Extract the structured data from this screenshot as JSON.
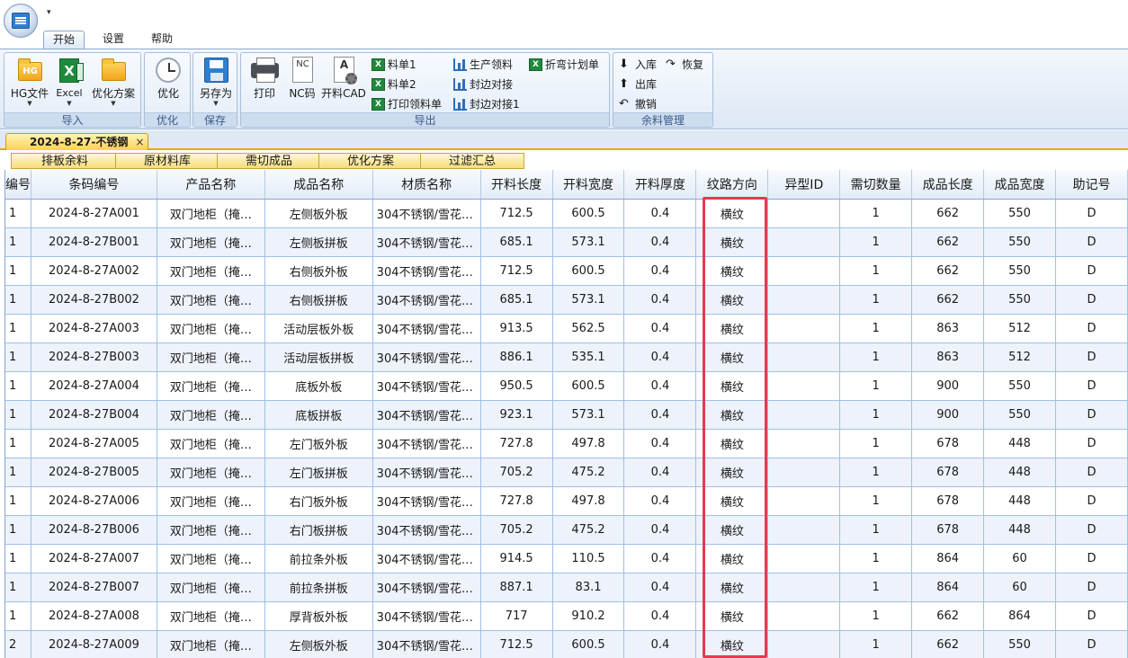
{
  "quick_access_glyph": "▾",
  "ribbon_tabs": [
    "开始",
    "设置",
    "帮助"
  ],
  "groups": {
    "import": {
      "label": "导入",
      "hg": {
        "icon_text": "HG",
        "label": "HG文件"
      },
      "excel": {
        "icon_text": "X",
        "label": "Excel"
      },
      "plan": {
        "label": "优化方案"
      }
    },
    "optimize": {
      "label": "优化",
      "button": "优化"
    },
    "save": {
      "label": "保存",
      "button": "另存为"
    },
    "export": {
      "label": "导出",
      "print": "打印",
      "nc": {
        "icon_text": "NC",
        "label": "NC码"
      },
      "cad": {
        "icon_text": "A",
        "label": "开料CAD"
      },
      "list1": "料单1",
      "list2": "料单2",
      "print_pick": "打印领料单",
      "prod_pick": "生产领料",
      "edge_join": "封边对接",
      "edge_join1": "封边对接1",
      "bend_plan": "折弯计划单"
    },
    "remnant": {
      "label": "余料管理",
      "in": "入库",
      "restore": "恢复",
      "out": "出库",
      "undo": "撤销"
    }
  },
  "document_tab": {
    "title": "2024-8-27-不锈钢",
    "close": "×"
  },
  "sub_tabs": [
    "排板余料",
    "原材料库",
    "需切成品",
    "优化方案",
    "过滤汇总"
  ],
  "grid": {
    "columns": [
      "编号",
      "条码编号",
      "产品名称",
      "成品名称",
      "材质名称",
      "开料长度",
      "开料宽度",
      "开料厚度",
      "纹路方向",
      "异型ID",
      "需切数量",
      "成品长度",
      "成品宽度",
      "助记号"
    ],
    "rows": [
      [
        "1",
        "2024-8-27A001",
        "双门地柜（掩…",
        "左侧板外板",
        "304不锈钢/雪花…",
        "712.5",
        "600.5",
        "0.4",
        "横纹",
        "",
        "1",
        "662",
        "550",
        "D"
      ],
      [
        "1",
        "2024-8-27B001",
        "双门地柜（掩…",
        "左侧板拼板",
        "304不锈钢/雪花…",
        "685.1",
        "573.1",
        "0.4",
        "横纹",
        "",
        "1",
        "662",
        "550",
        "D"
      ],
      [
        "1",
        "2024-8-27A002",
        "双门地柜（掩…",
        "右侧板外板",
        "304不锈钢/雪花…",
        "712.5",
        "600.5",
        "0.4",
        "横纹",
        "",
        "1",
        "662",
        "550",
        "D"
      ],
      [
        "1",
        "2024-8-27B002",
        "双门地柜（掩…",
        "右侧板拼板",
        "304不锈钢/雪花…",
        "685.1",
        "573.1",
        "0.4",
        "横纹",
        "",
        "1",
        "662",
        "550",
        "D"
      ],
      [
        "1",
        "2024-8-27A003",
        "双门地柜（掩…",
        "活动层板外板",
        "304不锈钢/雪花…",
        "913.5",
        "562.5",
        "0.4",
        "横纹",
        "",
        "1",
        "863",
        "512",
        "D"
      ],
      [
        "1",
        "2024-8-27B003",
        "双门地柜（掩…",
        "活动层板拼板",
        "304不锈钢/雪花…",
        "886.1",
        "535.1",
        "0.4",
        "横纹",
        "",
        "1",
        "863",
        "512",
        "D"
      ],
      [
        "1",
        "2024-8-27A004",
        "双门地柜（掩…",
        "底板外板",
        "304不锈钢/雪花…",
        "950.5",
        "600.5",
        "0.4",
        "横纹",
        "",
        "1",
        "900",
        "550",
        "D"
      ],
      [
        "1",
        "2024-8-27B004",
        "双门地柜（掩…",
        "底板拼板",
        "304不锈钢/雪花…",
        "923.1",
        "573.1",
        "0.4",
        "横纹",
        "",
        "1",
        "900",
        "550",
        "D"
      ],
      [
        "1",
        "2024-8-27A005",
        "双门地柜（掩…",
        "左门板外板",
        "304不锈钢/雪花…",
        "727.8",
        "497.8",
        "0.4",
        "横纹",
        "",
        "1",
        "678",
        "448",
        "D"
      ],
      [
        "1",
        "2024-8-27B005",
        "双门地柜（掩…",
        "左门板拼板",
        "304不锈钢/雪花…",
        "705.2",
        "475.2",
        "0.4",
        "横纹",
        "",
        "1",
        "678",
        "448",
        "D"
      ],
      [
        "1",
        "2024-8-27A006",
        "双门地柜（掩…",
        "右门板外板",
        "304不锈钢/雪花…",
        "727.8",
        "497.8",
        "0.4",
        "横纹",
        "",
        "1",
        "678",
        "448",
        "D"
      ],
      [
        "1",
        "2024-8-27B006",
        "双门地柜（掩…",
        "右门板拼板",
        "304不锈钢/雪花…",
        "705.2",
        "475.2",
        "0.4",
        "横纹",
        "",
        "1",
        "678",
        "448",
        "D"
      ],
      [
        "1",
        "2024-8-27A007",
        "双门地柜（掩…",
        "前拉条外板",
        "304不锈钢/雪花…",
        "914.5",
        "110.5",
        "0.4",
        "横纹",
        "",
        "1",
        "864",
        "60",
        "D"
      ],
      [
        "1",
        "2024-8-27B007",
        "双门地柜（掩…",
        "前拉条拼板",
        "304不锈钢/雪花…",
        "887.1",
        "83.1",
        "0.4",
        "横纹",
        "",
        "1",
        "864",
        "60",
        "D"
      ],
      [
        "1",
        "2024-8-27A008",
        "双门地柜（掩…",
        "厚背板外板",
        "304不锈钢/雪花…",
        "717",
        "910.2",
        "0.4",
        "横纹",
        "",
        "1",
        "662",
        "864",
        "D"
      ],
      [
        "2",
        "2024-8-27A009",
        "双门地柜（掩…",
        "左侧板外板",
        "304不锈钢/雪花…",
        "712.5",
        "600.5",
        "0.4",
        "横纹",
        "",
        "1",
        "662",
        "550",
        "D"
      ]
    ]
  },
  "colors": {
    "highlight": "#e8384f",
    "doc_tab": "#ffd24d",
    "ribbon": "#dde8f5"
  }
}
